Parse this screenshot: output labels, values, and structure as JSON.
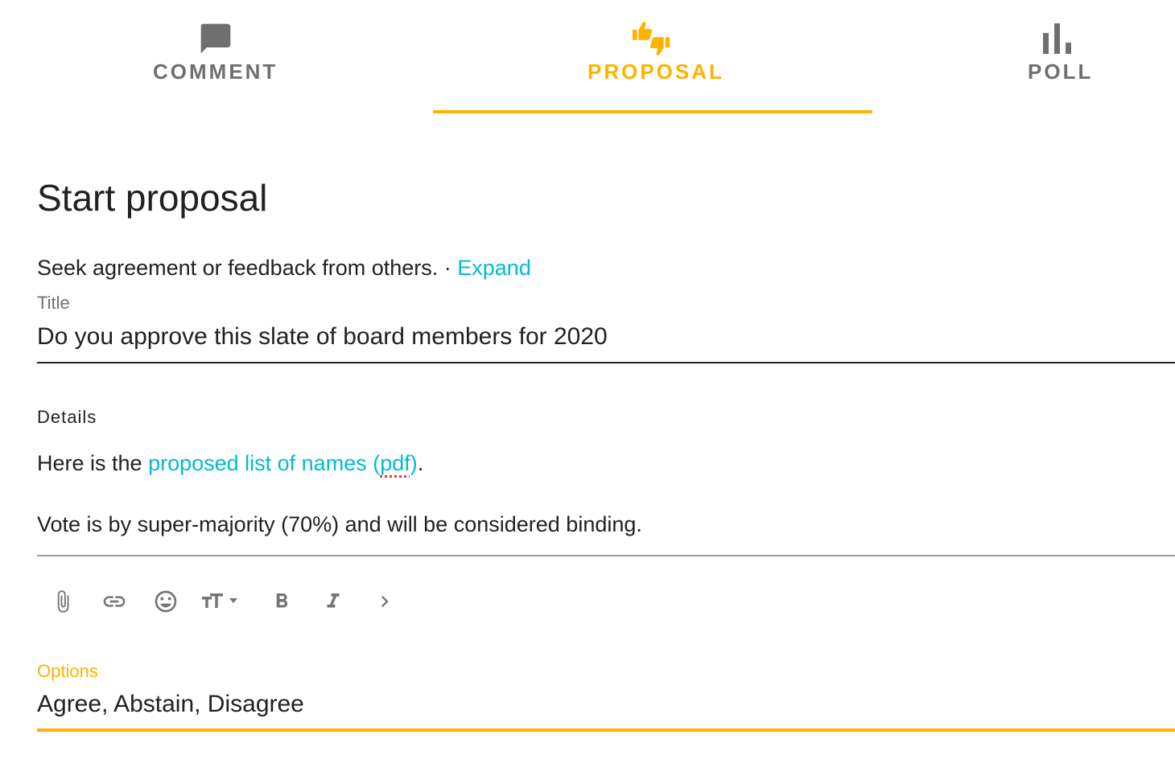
{
  "tabs": [
    {
      "label": "COMMENT",
      "icon": "comment-icon",
      "active": false
    },
    {
      "label": "PROPOSAL",
      "icon": "thumbs-up-down-icon",
      "active": true
    },
    {
      "label": "POLL",
      "icon": "bar-chart-icon",
      "active": false
    }
  ],
  "colors": {
    "accent": "#ffb300",
    "link": "#00bcd4",
    "inactive_tab": "#6f6f6f",
    "text": "#212121"
  },
  "heading": "Start proposal",
  "description": {
    "text": "Seek agreement or feedback from others. · ",
    "expand_link": "Expand"
  },
  "title_field": {
    "label": "Title",
    "value": "Do you approve this slate of board members for 2020"
  },
  "details_field": {
    "label": "Details",
    "paragraph1_prefix": "Here is the ",
    "paragraph1_link_main": "proposed list of names (",
    "paragraph1_link_misspelled": "pdf",
    "paragraph1_link_end": ")",
    "paragraph1_suffix": ".",
    "paragraph2": "Vote is by super-majority (70%) and will be considered binding."
  },
  "toolbar": {
    "tools": [
      "attach-icon",
      "link-icon",
      "emoji-icon",
      "text-size-icon",
      "bold-icon",
      "italic-icon",
      "chevron-right-icon"
    ]
  },
  "options_field": {
    "label": "Options",
    "value": "Agree, Abstain, Disagree"
  }
}
